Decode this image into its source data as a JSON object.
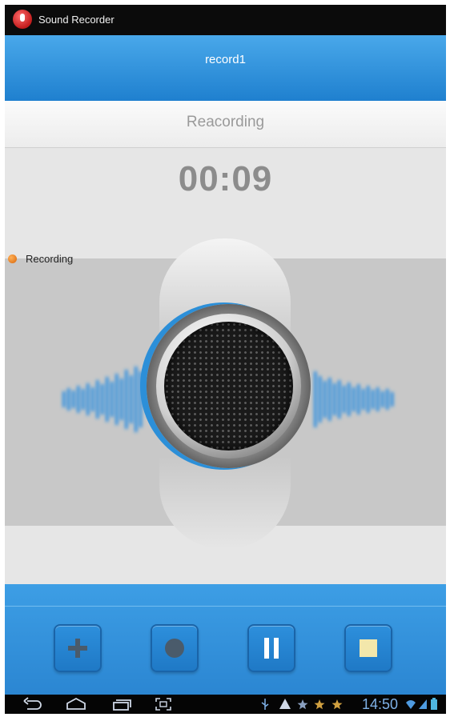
{
  "app": {
    "title": "Sound Recorder",
    "icon": "microphone-icon"
  },
  "header": {
    "record_name": "record1"
  },
  "status": {
    "text": "Reacording"
  },
  "timer": {
    "elapsed": "00:09"
  },
  "indicator": {
    "label": "Recording",
    "color": "#e07a14"
  },
  "controls": [
    {
      "name": "add-button",
      "icon": "plus-icon"
    },
    {
      "name": "record-button",
      "icon": "record-icon"
    },
    {
      "name": "pause-button",
      "icon": "pause-icon"
    },
    {
      "name": "stop-button",
      "icon": "stop-icon"
    }
  ],
  "system_bar": {
    "time": "14:50",
    "nav_icons": [
      "back-icon",
      "home-icon",
      "recent-apps-icon",
      "screenshot-icon"
    ],
    "status_icons": [
      "usb-icon",
      "warning-icon",
      "star-icon",
      "star-icon",
      "star-icon",
      "wifi-icon",
      "signal-icon",
      "battery-icon"
    ]
  },
  "colors": {
    "accent_blue": "#2b86d2",
    "header_blue": "#49a8ea",
    "stop_square": "#f3e7ab"
  }
}
